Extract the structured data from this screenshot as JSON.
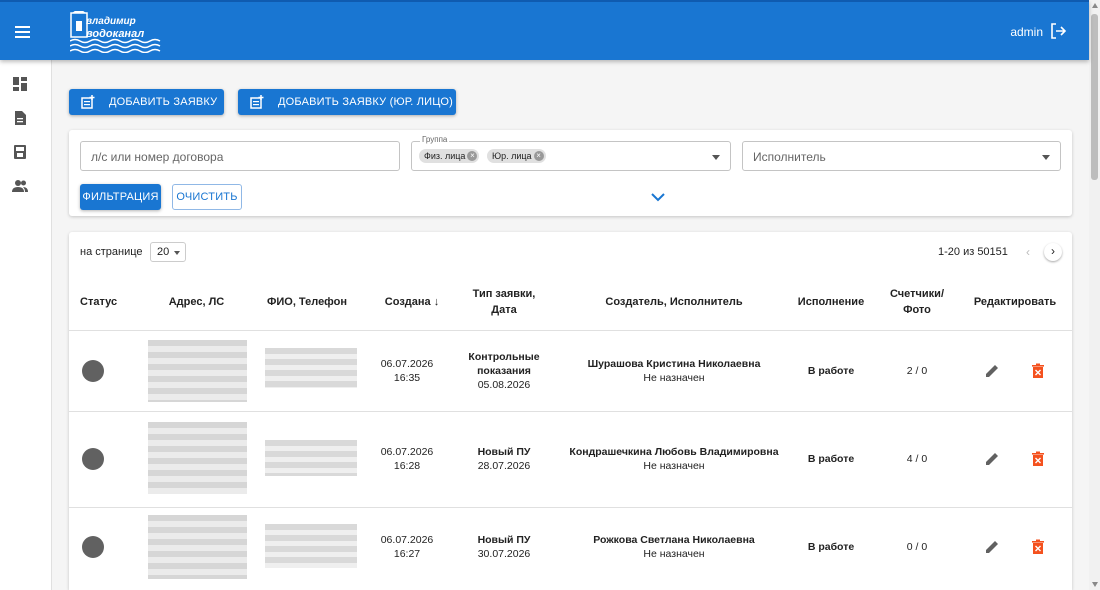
{
  "header": {
    "logo_line1": "владимир",
    "logo_line2": "водоканал",
    "user": "admin"
  },
  "sidebar": {
    "items": [
      {
        "icon": "dashboard-icon"
      },
      {
        "icon": "document-icon"
      },
      {
        "icon": "meter-icon"
      },
      {
        "icon": "users-icon"
      }
    ]
  },
  "actions": {
    "add_request": "ДОБАВИТЬ ЗАЯВКУ",
    "add_request_legal": "ДОБАВИТЬ ЗАЯВКУ (ЮР. ЛИЦО)"
  },
  "filters": {
    "account_placeholder": "л/с или номер договора",
    "group_label": "Группа",
    "group_chips": [
      "Физ. лица",
      "Юр. лица"
    ],
    "executor_placeholder": "Исполнитель",
    "filter_button": "ФИЛЬТРАЦИЯ",
    "clear_button": "ОЧИСТИТЬ"
  },
  "table": {
    "per_page_label": "на странице",
    "per_page_value": "20",
    "range": "1-20 из 50151",
    "columns": {
      "status": "Статус",
      "address": "Адрес, ЛС",
      "name_phone": "ФИО, Телефон",
      "created": "Создана ↓",
      "type_line1": "Тип заявки,",
      "type_line2": "Дата",
      "creator_executor": "Создатель, Исполнитель",
      "execution": "Исполнение",
      "meters_line1": "Счетчики/",
      "meters_line2": "Фото",
      "edit": "Редактировать"
    },
    "rows": [
      {
        "created_date": "06.07.2026",
        "created_time": "16:35",
        "type_lines": [
          "Контрольные",
          "показания"
        ],
        "type_date": "05.08.2026",
        "creator": "Шурашова Кристина Николаевна",
        "executor": "Не назначен",
        "execution": "В работе",
        "meters": "2 / 0"
      },
      {
        "created_date": "06.07.2026",
        "created_time": "16:28",
        "type_lines": [
          "Новый ПУ"
        ],
        "type_date": "28.07.2026",
        "creator": "Кондрашечкина Любовь Владимировна",
        "executor": "Не назначен",
        "execution": "В работе",
        "meters": "4 / 0"
      },
      {
        "created_date": "06.07.2026",
        "created_time": "16:27",
        "type_lines": [
          "Новый ПУ"
        ],
        "type_date": "30.07.2026",
        "creator": "Рожкова Светлана Николаевна",
        "executor": "Не назначен",
        "execution": "В работе",
        "meters": "0 / 0"
      }
    ]
  },
  "colors": {
    "primary": "#1976d2",
    "status_gray": "#616161",
    "delete_orange": "#f4511e"
  }
}
